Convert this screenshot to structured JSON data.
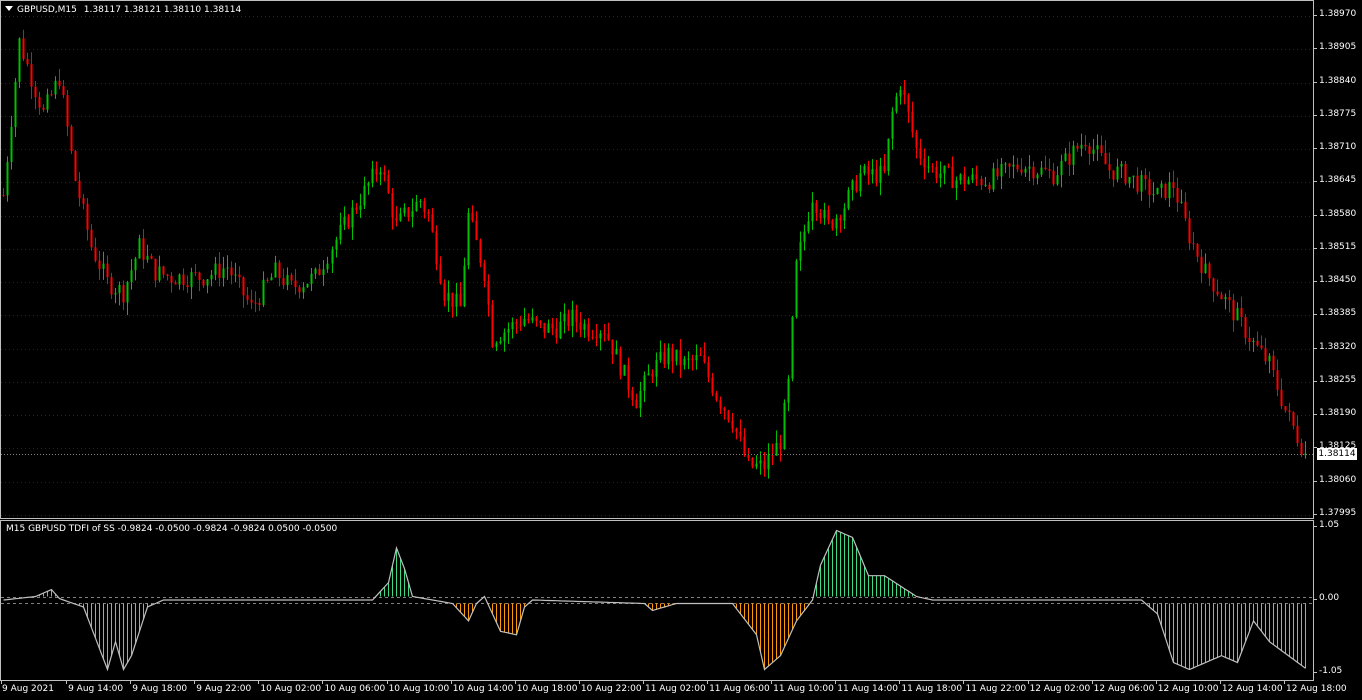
{
  "window": {
    "title_symbol": "GBPUSD,M15",
    "ohlc": "1.38117 1.38121 1.38110 1.38114",
    "menu_arrow_icon": "triangle-down-icon"
  },
  "colors": {
    "background": "#000000",
    "bull": "#00c000",
    "bear": "#ff0000",
    "grid": "#1e1e5a",
    "hist_positive": "#3ddc84",
    "hist_negative": "#ff9900",
    "tdfi_line": "#c0c0c0"
  },
  "price_axis": {
    "ticks": [
      "1.38970",
      "1.38905",
      "1.38840",
      "1.38775",
      "1.38710",
      "1.38645",
      "1.38580",
      "1.38515",
      "1.38450",
      "1.38385",
      "1.38320",
      "1.38255",
      "1.38190",
      "1.38125",
      "1.38060",
      "1.37995"
    ],
    "current_price": "1.38114"
  },
  "indicator": {
    "title": "M15 GBPUSD TDFI of SS -0.9824 -0.0500 -0.9824 -0.9824 0.0500 -0.0500",
    "ticks": [
      "1.05",
      "0.00",
      "-1.05"
    ],
    "levels": [
      0.05,
      -0.05
    ]
  },
  "time_axis": {
    "labels": [
      "9 Aug 2021",
      "9 Aug 14:00",
      "9 Aug 18:00",
      "9 Aug 22:00",
      "10 Aug 02:00",
      "10 Aug 06:00",
      "10 Aug 10:00",
      "10 Aug 14:00",
      "10 Aug 18:00",
      "10 Aug 22:00",
      "11 Aug 02:00",
      "11 Aug 06:00",
      "11 Aug 10:00",
      "11 Aug 14:00",
      "11 Aug 18:00",
      "11 Aug 22:00",
      "12 Aug 02:00",
      "12 Aug 06:00",
      "12 Aug 10:00",
      "12 Aug 14:00",
      "12 Aug 18:00"
    ]
  },
  "chart_data": [
    {
      "type": "candlestick",
      "symbol": "GBPUSD",
      "timeframe": "M15",
      "ylim": [
        1.37995,
        1.3897
      ],
      "x_range": [
        "9 Aug 2021 10:00",
        "12 Aug 19:15"
      ],
      "close_path": [
        [
          "9 Aug 2021 10:00",
          1.3862
        ],
        [
          "9 Aug 11:00",
          1.3892
        ],
        [
          "9 Aug 12:30",
          1.3878
        ],
        [
          "9 Aug 13:30",
          1.3885
        ],
        [
          "9 Aug 14:30",
          1.3865
        ],
        [
          "9 Aug 15:30",
          1.3852
        ],
        [
          "9 Aug 16:30",
          1.3845
        ],
        [
          "9 Aug 17:30",
          1.3843
        ],
        [
          "9 Aug 18:30",
          1.3852
        ],
        [
          "9 Aug 19:30",
          1.3847
        ],
        [
          "9 Aug 20:30",
          1.3846
        ],
        [
          "9 Aug 21:30",
          1.3846
        ],
        [
          "9 Aug 22:30",
          1.3846
        ],
        [
          "10 Aug 00:00",
          1.3848
        ],
        [
          "10 Aug 01:30",
          1.384
        ],
        [
          "10 Aug 03:00",
          1.3847
        ],
        [
          "10 Aug 04:00",
          1.3844
        ],
        [
          "10 Aug 05:30",
          1.3846
        ],
        [
          "10 Aug 06:30",
          1.3852
        ],
        [
          "10 Aug 08:00",
          1.386
        ],
        [
          "10 Aug 09:30",
          1.3868
        ],
        [
          "10 Aug 10:30",
          1.3856
        ],
        [
          "10 Aug 11:00",
          1.3858
        ],
        [
          "10 Aug 12:00",
          1.3861
        ],
        [
          "10 Aug 12:30",
          1.3858
        ],
        [
          "10 Aug 13:30",
          1.3843
        ],
        [
          "10 Aug 14:30",
          1.384
        ],
        [
          "10 Aug 15:00",
          1.3858
        ],
        [
          "10 Aug 16:00",
          1.3847
        ],
        [
          "10 Aug 16:30",
          1.3834
        ],
        [
          "10 Aug 17:30",
          1.3836
        ],
        [
          "10 Aug 18:30",
          1.3838
        ],
        [
          "10 Aug 19:30",
          1.3836
        ],
        [
          "10 Aug 20:30",
          1.3836
        ],
        [
          "10 Aug 21:30",
          1.3838
        ],
        [
          "10 Aug 22:30",
          1.3836
        ],
        [
          "10 Aug 23:30",
          1.3836
        ],
        [
          "11 Aug 01:00",
          1.3825
        ],
        [
          "11 Aug 01:30",
          1.3822
        ],
        [
          "11 Aug 02:30",
          1.3828
        ],
        [
          "11 Aug 03:30",
          1.3831
        ],
        [
          "11 Aug 04:30",
          1.3829
        ],
        [
          "11 Aug 05:30",
          1.383
        ],
        [
          "11 Aug 06:30",
          1.3823
        ],
        [
          "11 Aug 07:30",
          1.3818
        ],
        [
          "11 Aug 08:30",
          1.3809
        ],
        [
          "11 Aug 09:30",
          1.3809
        ],
        [
          "11 Aug 10:30",
          1.3814
        ],
        [
          "11 Aug 11:00",
          1.3825
        ],
        [
          "11 Aug 11:30",
          1.3848
        ],
        [
          "11 Aug 12:30",
          1.3862
        ],
        [
          "11 Aug 13:30",
          1.3856
        ],
        [
          "11 Aug 14:30",
          1.386
        ],
        [
          "11 Aug 15:30",
          1.3866
        ],
        [
          "11 Aug 17:00",
          1.3866
        ],
        [
          "11 Aug 17:30",
          1.3878
        ],
        [
          "11 Aug 18:00",
          1.3884
        ],
        [
          "11 Aug 19:00",
          1.3871
        ],
        [
          "11 Aug 20:00",
          1.3867
        ],
        [
          "11 Aug 21:30",
          1.3865
        ],
        [
          "11 Aug 23:30",
          1.3865
        ],
        [
          "12 Aug 01:30",
          1.3868
        ],
        [
          "12 Aug 03:30",
          1.3866
        ],
        [
          "12 Aug 05:30",
          1.3873
        ],
        [
          "12 Aug 07:00",
          1.3867
        ],
        [
          "12 Aug 08:00",
          1.3866
        ],
        [
          "12 Aug 09:00",
          1.3864
        ],
        [
          "12 Aug 10:00",
          1.3862
        ],
        [
          "12 Aug 11:00",
          1.3864
        ],
        [
          "12 Aug 12:00",
          1.3854
        ],
        [
          "12 Aug 13:00",
          1.3847
        ],
        [
          "12 Aug 15:00",
          1.3838
        ],
        [
          "12 Aug 16:00",
          1.3833
        ],
        [
          "12 Aug 17:00",
          1.3829
        ],
        [
          "12 Aug 18:00",
          1.382
        ],
        [
          "12 Aug 19:15",
          1.38114
        ]
      ]
    },
    {
      "type": "area",
      "name": "TDFI",
      "ylim": [
        -1.05,
        1.05
      ],
      "levels": [
        0.05,
        -0.05
      ],
      "x_range": [
        "9 Aug 2021 10:00",
        "12 Aug 19:15"
      ],
      "points": [
        [
          "9 Aug 2021 10:00",
          0.0
        ],
        [
          "9 Aug 12:00",
          0.05
        ],
        [
          "9 Aug 13:00",
          0.15
        ],
        [
          "9 Aug 13:30",
          0.02
        ],
        [
          "9 Aug 15:00",
          -0.1
        ],
        [
          "9 Aug 16:00",
          -0.7
        ],
        [
          "9 Aug 16:30",
          -1.0
        ],
        [
          "9 Aug 17:00",
          -0.6
        ],
        [
          "9 Aug 17:30",
          -1.0
        ],
        [
          "9 Aug 18:00",
          -0.8
        ],
        [
          "9 Aug 19:00",
          -0.1
        ],
        [
          "9 Aug 20:00",
          0.0
        ],
        [
          "10 Aug 09:00",
          0.0
        ],
        [
          "10 Aug 10:00",
          0.25
        ],
        [
          "10 Aug 10:30",
          0.75
        ],
        [
          "10 Aug 11:00",
          0.45
        ],
        [
          "10 Aug 11:30",
          0.05
        ],
        [
          "10 Aug 14:00",
          -0.05
        ],
        [
          "10 Aug 15:00",
          -0.3
        ],
        [
          "10 Aug 15:30",
          -0.05
        ],
        [
          "10 Aug 16:00",
          0.05
        ],
        [
          "10 Aug 17:00",
          -0.45
        ],
        [
          "10 Aug 18:00",
          -0.5
        ],
        [
          "10 Aug 18:30",
          -0.1
        ],
        [
          "10 Aug 19:00",
          0.0
        ],
        [
          "11 Aug 02:00",
          -0.05
        ],
        [
          "11 Aug 02:30",
          -0.15
        ],
        [
          "11 Aug 04:00",
          -0.05
        ],
        [
          "11 Aug 07:30",
          -0.05
        ],
        [
          "11 Aug 09:00",
          -0.5
        ],
        [
          "11 Aug 09:30",
          -1.0
        ],
        [
          "11 Aug 10:30",
          -0.8
        ],
        [
          "11 Aug 11:30",
          -0.3
        ],
        [
          "11 Aug 12:30",
          0.0
        ],
        [
          "11 Aug 13:00",
          0.5
        ],
        [
          "11 Aug 14:00",
          1.0
        ],
        [
          "11 Aug 15:00",
          0.9
        ],
        [
          "11 Aug 16:00",
          0.35
        ],
        [
          "11 Aug 17:00",
          0.35
        ],
        [
          "11 Aug 18:00",
          0.2
        ],
        [
          "11 Aug 19:00",
          0.05
        ],
        [
          "11 Aug 20:00",
          0.0
        ],
        [
          "12 Aug 09:00",
          0.0
        ],
        [
          "12 Aug 10:00",
          -0.2
        ],
        [
          "12 Aug 11:00",
          -0.9
        ],
        [
          "12 Aug 12:00",
          -1.0
        ],
        [
          "12 Aug 13:00",
          -0.9
        ],
        [
          "12 Aug 14:00",
          -0.8
        ],
        [
          "12 Aug 15:00",
          -0.9
        ],
        [
          "12 Aug 16:00",
          -0.3
        ],
        [
          "12 Aug 17:00",
          -0.6
        ],
        [
          "12 Aug 19:15",
          -0.9824
        ]
      ]
    }
  ]
}
